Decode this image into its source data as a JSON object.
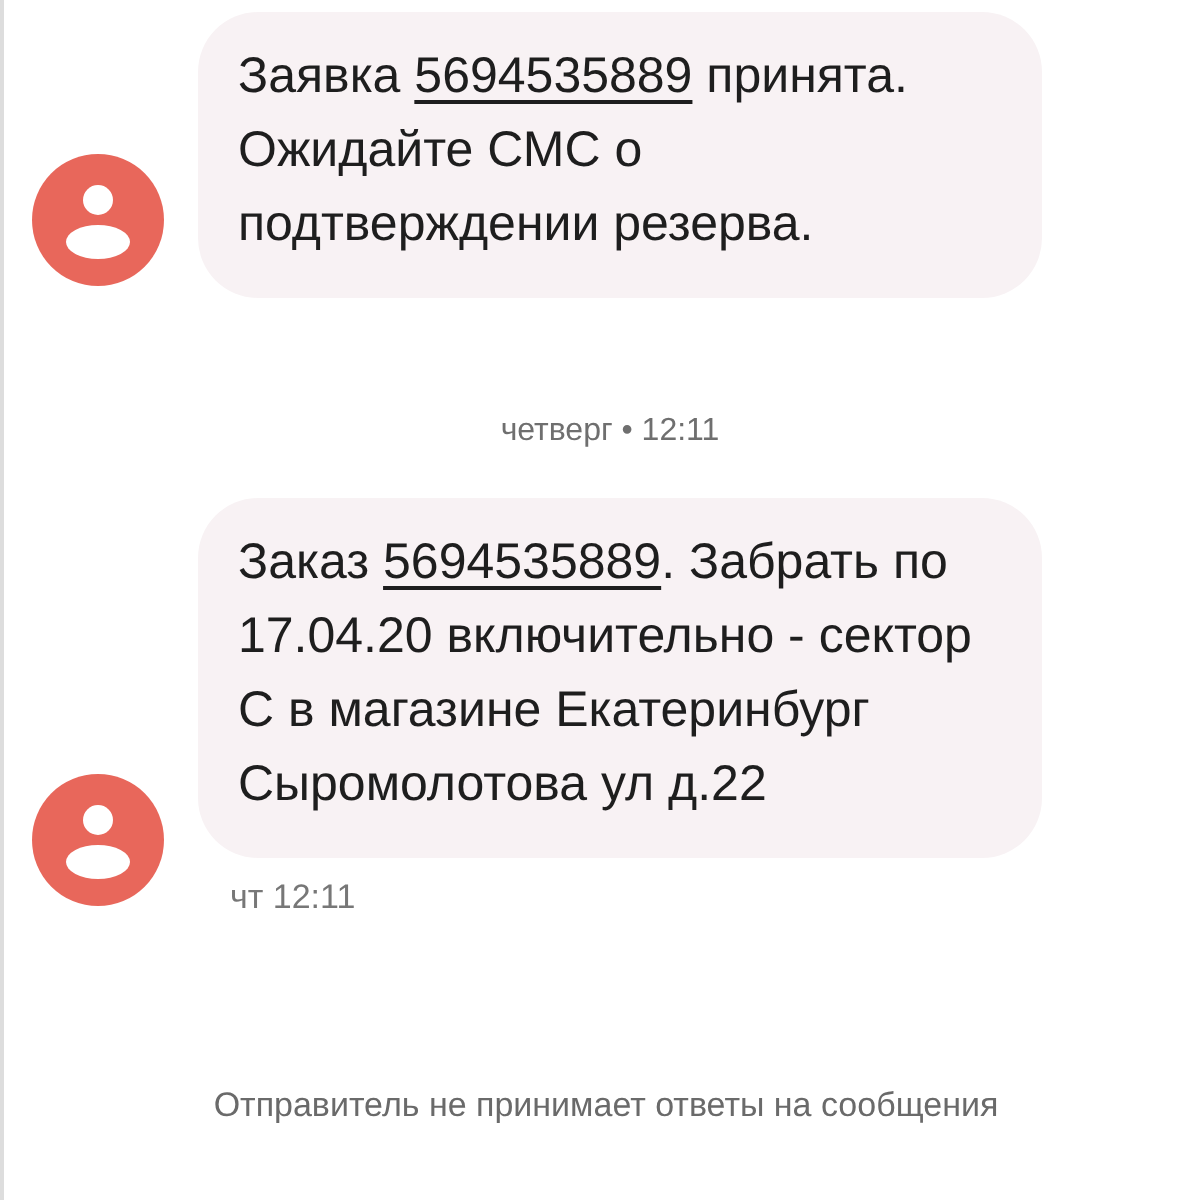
{
  "messages": [
    {
      "kind": "message",
      "parts": [
        {
          "kind": "text",
          "text": "Заявка "
        },
        {
          "kind": "link",
          "text": "5694535889"
        },
        {
          "kind": "text",
          "text": " принята. Ожидайте СМС о подтверждении резерва."
        }
      ]
    },
    {
      "kind": "separator",
      "text": "четверг • 12:11"
    },
    {
      "kind": "message",
      "parts": [
        {
          "kind": "text",
          "text": "Заказ "
        },
        {
          "kind": "link",
          "text": "5694535889"
        },
        {
          "kind": "text",
          "text": ". Забрать по 17.04.20 включительно - сектор С в магазине Екатеринбург Сыромолотова ул д.22"
        }
      ],
      "time": "чт 12:11"
    }
  ],
  "footer": "Отправитель не принимает ответы на сообщения"
}
